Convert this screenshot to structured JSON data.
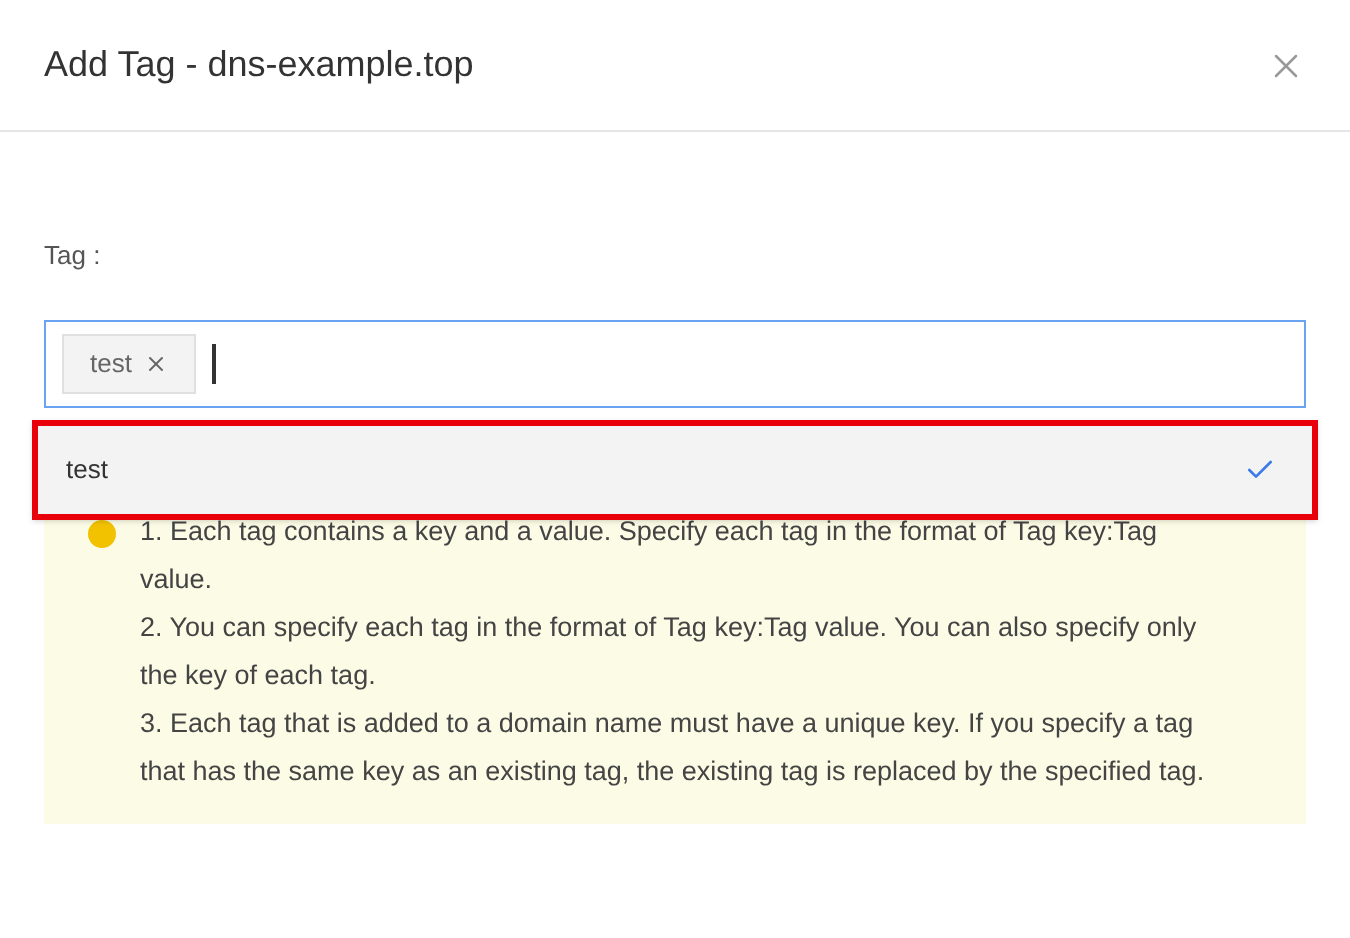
{
  "dialog": {
    "title": "Add Tag - dns-example.top"
  },
  "field": {
    "label": "Tag :",
    "tags": [
      {
        "label": "test"
      }
    ]
  },
  "dropdown": {
    "options": [
      {
        "label": "test",
        "selected": true
      }
    ]
  },
  "notice": {
    "lines": [
      "1. Each tag contains a key and a value. Specify each tag in the format of Tag key:Tag value.",
      "2. You can specify each tag in the format of Tag key:Tag value. You can also specify only the key of each tag.",
      "3. Each tag that is added to a domain name must have a unique key. If you specify a tag that has the same key as an existing tag, the existing tag is replaced by the specified tag."
    ]
  }
}
